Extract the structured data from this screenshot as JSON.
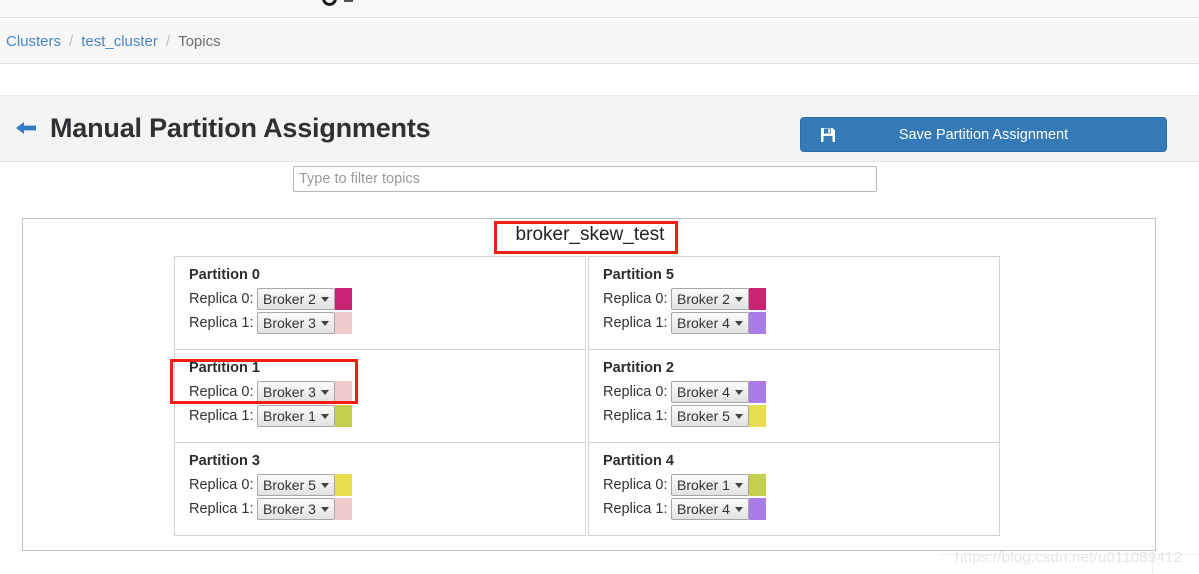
{
  "breadcrumb": {
    "items": [
      {
        "label": "Clusters",
        "type": "link"
      },
      {
        "label": "test_cluster",
        "type": "link"
      },
      {
        "label": "Topics",
        "type": "current"
      }
    ],
    "separator": "/"
  },
  "header": {
    "back_icon": "arrow-left-icon",
    "title": "Manual Partition Assignments",
    "save_button": {
      "label": "Save Partition Assignment",
      "icon": "save-floppy-icon",
      "color": "#337ab7"
    }
  },
  "filter": {
    "placeholder": "Type to filter topics",
    "value": ""
  },
  "topic": {
    "name": "broker_skew_test",
    "highlighted": true,
    "highlight_color": "#f01f14"
  },
  "broker_colors": {
    "Broker 1": "#c4ce4f",
    "Broker 2": "#c72573",
    "Broker 3": "#f0cbcb",
    "Broker 4": "#ab7ce8",
    "Broker 5": "#e6de4f"
  },
  "partitions": {
    "left": [
      {
        "title": "Partition 0",
        "replicas": [
          {
            "label": "Replica 0:",
            "broker": "Broker 2",
            "color": "#c72573"
          },
          {
            "label": "Replica 1:",
            "broker": "Broker 3",
            "color": "#f0cbcb"
          }
        ]
      },
      {
        "title": "Partition 1",
        "highlighted": true,
        "replicas": [
          {
            "label": "Replica 0:",
            "broker": "Broker 3",
            "color": "#f0cbcb"
          },
          {
            "label": "Replica 1:",
            "broker": "Broker 1",
            "color": "#c4ce4f"
          }
        ]
      },
      {
        "title": "Partition 3",
        "replicas": [
          {
            "label": "Replica 0:",
            "broker": "Broker 5",
            "color": "#e6de4f"
          },
          {
            "label": "Replica 1:",
            "broker": "Broker 3",
            "color": "#f0cbcb"
          }
        ]
      }
    ],
    "right": [
      {
        "title": "Partition 5",
        "replicas": [
          {
            "label": "Replica 0:",
            "broker": "Broker 2",
            "color": "#c72573"
          },
          {
            "label": "Replica 1:",
            "broker": "Broker 4",
            "color": "#ab7ce8"
          }
        ]
      },
      {
        "title": "Partition 2",
        "replicas": [
          {
            "label": "Replica 0:",
            "broker": "Broker 4",
            "color": "#ab7ce8"
          },
          {
            "label": "Replica 1:",
            "broker": "Broker 5",
            "color": "#e6de4f"
          }
        ]
      },
      {
        "title": "Partition 4",
        "replicas": [
          {
            "label": "Replica 0:",
            "broker": "Broker 1",
            "color": "#c4ce4f"
          },
          {
            "label": "Replica 1:",
            "broker": "Broker 4",
            "color": "#ab7ce8"
          }
        ]
      }
    ]
  },
  "watermark": {
    "text": "https://blog.csdn.net/u011089412"
  }
}
